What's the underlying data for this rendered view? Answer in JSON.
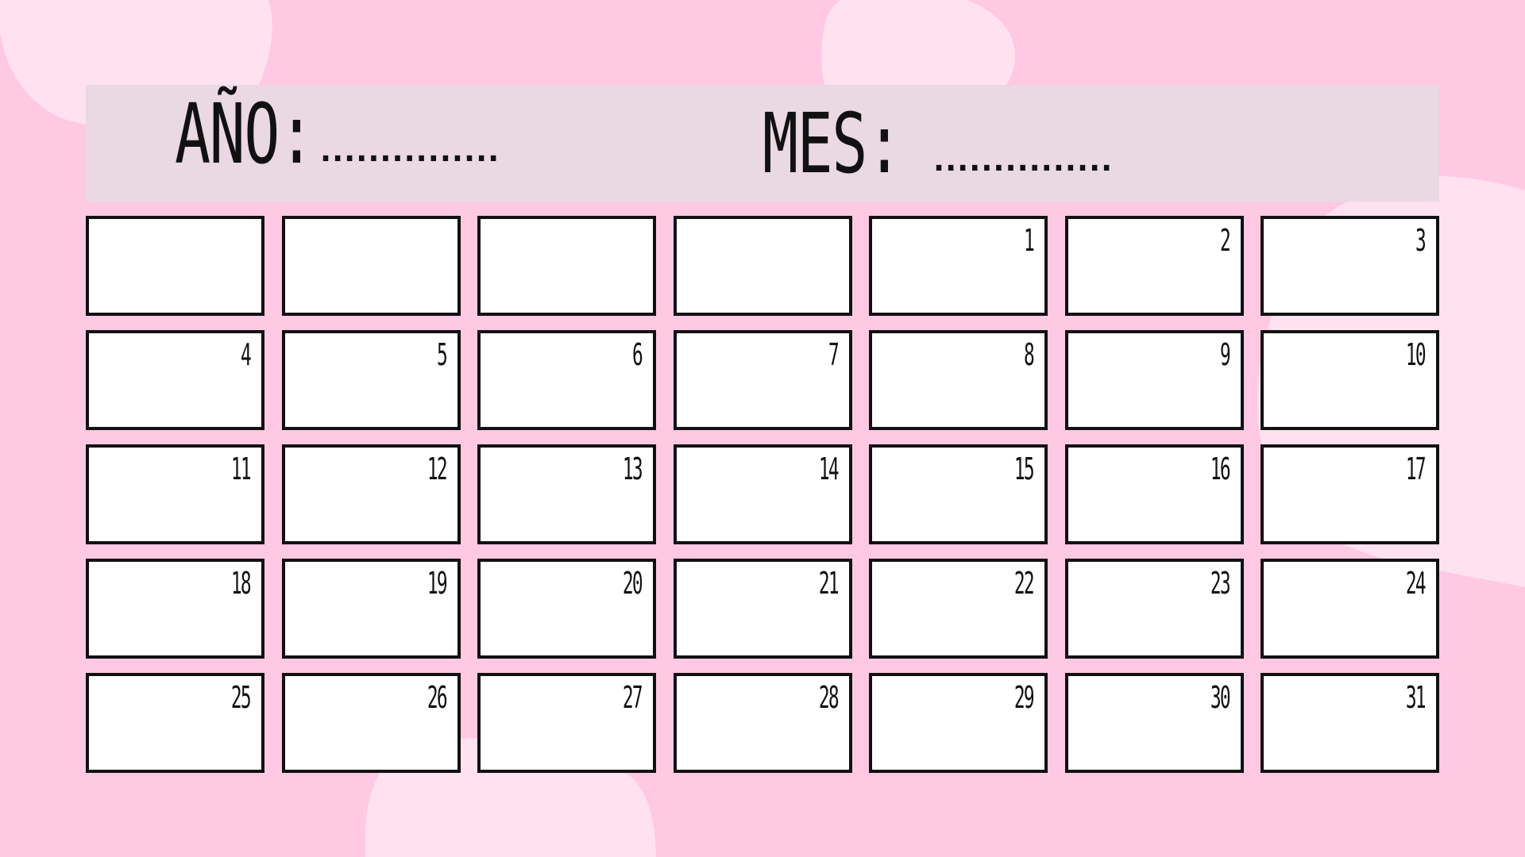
{
  "colors": {
    "background": "#ffc8e3",
    "blob": "#ffe1ef",
    "header_band": "#ead8e2",
    "cell_fill": "#ffffff",
    "cell_border": "#111111"
  },
  "header": {
    "year_label": "AÑO:",
    "year_dots": "...............",
    "month_label": "MES:",
    "month_dots": "..............."
  },
  "calendar": {
    "weeks": [
      [
        "",
        "",
        "",
        "",
        "1",
        "2",
        "3"
      ],
      [
        "4",
        "5",
        "6",
        "7",
        "8",
        "9",
        "10"
      ],
      [
        "11",
        "12",
        "13",
        "14",
        "15",
        "16",
        "17"
      ],
      [
        "18",
        "19",
        "20",
        "21",
        "22",
        "23",
        "24"
      ],
      [
        "25",
        "26",
        "27",
        "28",
        "29",
        "30",
        "31"
      ]
    ]
  }
}
